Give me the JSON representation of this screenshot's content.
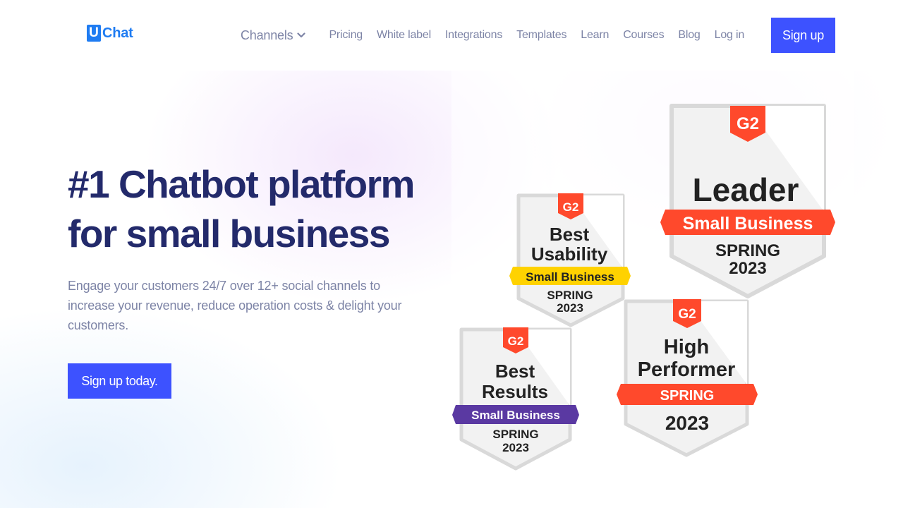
{
  "header": {
    "logo_mark": "U",
    "logo_text": "Chat",
    "nav": {
      "channels": "Channels",
      "pricing": "Pricing",
      "white_label": "White label",
      "integrations": "Integrations",
      "templates": "Templates",
      "learn": "Learn",
      "courses": "Courses",
      "blog": "Blog",
      "login": "Log in"
    },
    "signup": "Sign up"
  },
  "hero": {
    "title_line1": "#1 Chatbot platform",
    "title_line2": "for small business",
    "subtitle": "Engage your customers 24/7 over 12+ social channels to increase your revenue, reduce operation costs & delight your customers.",
    "cta": "Sign up today."
  },
  "badges": {
    "leader": {
      "line1": "Leader",
      "ribbon": "Small Business",
      "season": "SPRING",
      "year": "2023",
      "ribbon_color": "#ff492c"
    },
    "usability": {
      "line1": "Best",
      "line2": "Usability",
      "ribbon": "Small Business",
      "season": "SPRING",
      "year": "2023",
      "ribbon_color": "#ffd200"
    },
    "results": {
      "line1": "Best",
      "line2": "Results",
      "ribbon": "Small Business",
      "season": "SPRING",
      "year": "2023",
      "ribbon_color": "#5a39a2"
    },
    "performer": {
      "line1": "High",
      "line2": "Performer",
      "ribbon": "SPRING",
      "year": "2023",
      "ribbon_color": "#ff492c"
    },
    "g2_label": "G2",
    "g2_color": "#ff492c"
  },
  "colors": {
    "brand_blue": "#3d52ff",
    "logo_blue": "#1f7cf2",
    "heading": "#232a6b",
    "muted": "#7d84a6"
  }
}
